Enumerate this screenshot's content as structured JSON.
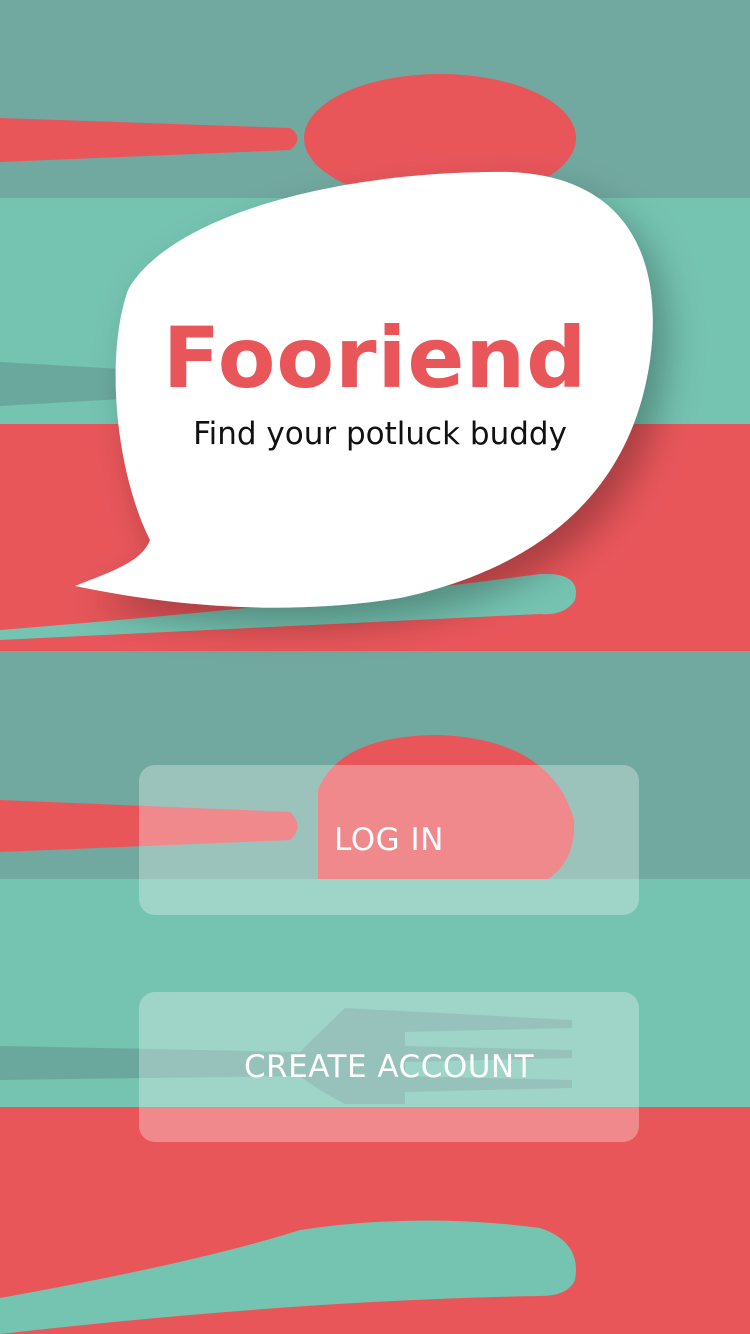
{
  "app": {
    "title": "Fooriend",
    "tagline": "Find your potluck buddy"
  },
  "actions": {
    "login_label": "LOG IN",
    "create_account_label": "CREATE ACCOUNT"
  },
  "colors": {
    "coral": "#e8565a",
    "teal_dark": "#71a8a0",
    "teal_light": "#75c3b1",
    "white": "#ffffff"
  },
  "icons": [
    "spoon-icon",
    "fork-icon",
    "knife-icon",
    "speech-bubble"
  ]
}
